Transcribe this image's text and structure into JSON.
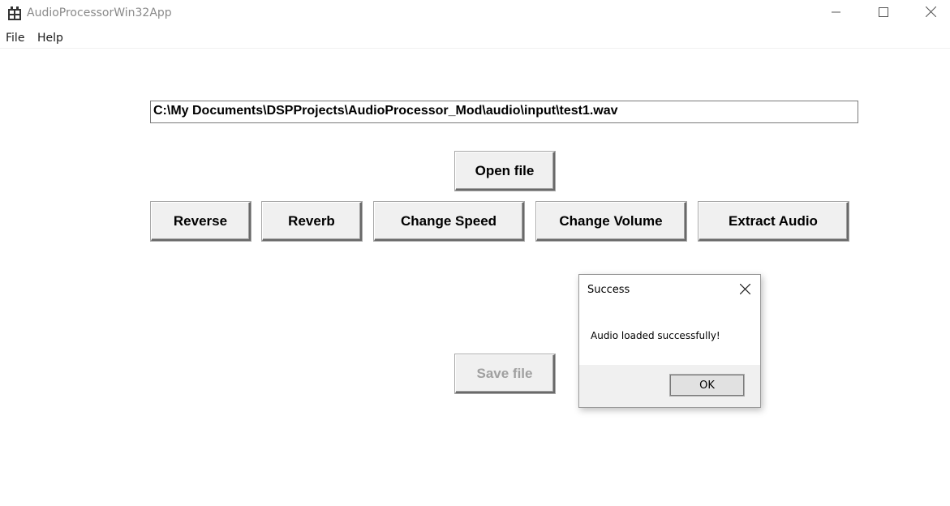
{
  "window": {
    "title": "AudioProcessorWin32App"
  },
  "menu": {
    "file": "File",
    "help": "Help"
  },
  "main": {
    "file_path": "C:\\My Documents\\DSPProjects\\AudioProcessor_Mod\\audio\\input\\test1.wav",
    "open_button": "Open file",
    "effects": {
      "reverse": "Reverse",
      "reverb": "Reverb",
      "change_speed": "Change Speed",
      "change_volume": "Change Volume",
      "extract_audio": "Extract Audio"
    },
    "save_button": "Save file",
    "save_enabled": false
  },
  "dialog": {
    "title": "Success",
    "message": "Audio loaded successfully!",
    "ok_button": "OK"
  },
  "icons": {
    "app": "app-icon",
    "minimize": "minimize-icon",
    "maximize": "maximize-icon",
    "close": "close-icon",
    "dialog_close": "close-icon"
  },
  "colors": {
    "title_text": "#8a8a8a",
    "button_face": "#f0f0f0",
    "disabled_text": "#a0a0a0",
    "dialog_footer": "#f0f0f0"
  }
}
